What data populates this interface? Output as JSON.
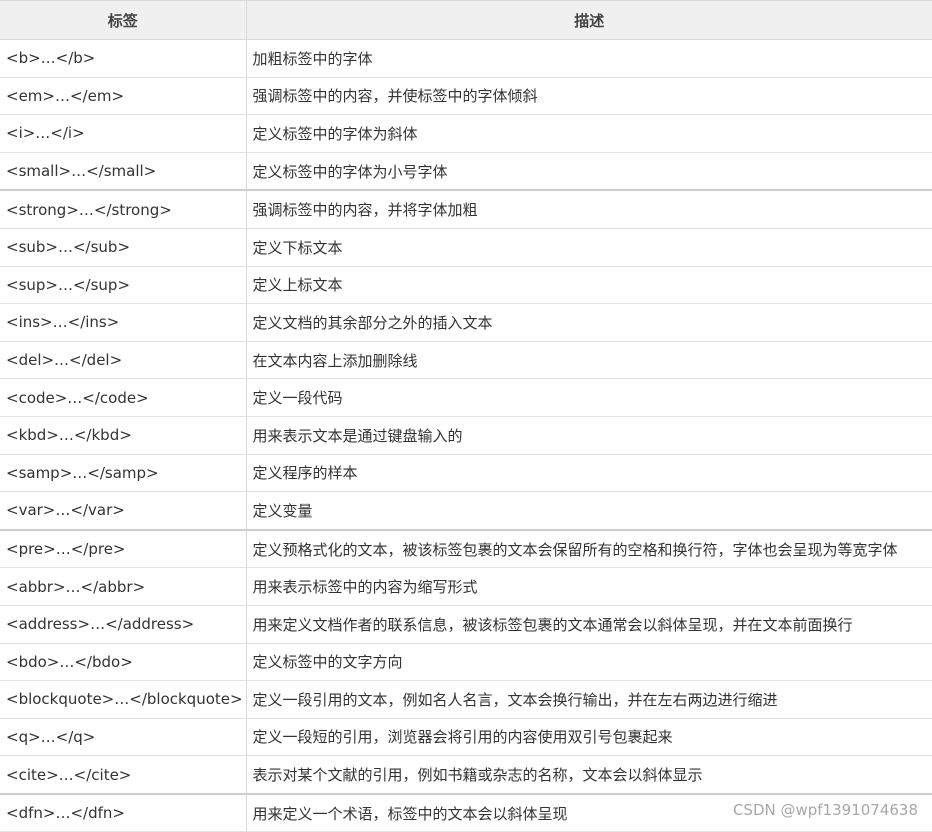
{
  "header": {
    "tag_label": "标签",
    "desc_label": "描述"
  },
  "rows": [
    {
      "tag": "<b>…</b>",
      "desc": "加粗标签中的字体"
    },
    {
      "tag": "<em>…</em>",
      "desc": "强调标签中的内容，并使标签中的字体倾斜"
    },
    {
      "tag": "<i>…</i>",
      "desc": "定义标签中的字体为斜体"
    },
    {
      "tag": "<small>…</small>",
      "desc": "定义标签中的字体为小号字体"
    },
    {
      "tag": "<strong>…</strong>",
      "desc": "强调标签中的内容，并将字体加粗"
    },
    {
      "tag": "<sub>…</sub>",
      "desc": "定义下标文本"
    },
    {
      "tag": "<sup>…</sup>",
      "desc": "定义上标文本"
    },
    {
      "tag": "<ins>…</ins>",
      "desc": "定义文档的其余部分之外的插入文本"
    },
    {
      "tag": "<del>…</del>",
      "desc": "在文本内容上添加删除线"
    },
    {
      "tag": "<code>…</code>",
      "desc": "定义一段代码"
    },
    {
      "tag": "<kbd>…</kbd>",
      "desc": "用来表示文本是通过键盘输入的"
    },
    {
      "tag": "<samp>…</samp>",
      "desc": "定义程序的样本"
    },
    {
      "tag": "<var>…</var>",
      "desc": "定义变量"
    },
    {
      "tag": "<pre>…</pre>",
      "desc": "定义预格式化的文本，被该标签包裹的文本会保留所有的空格和换行符，字体也会呈现为等宽字体"
    },
    {
      "tag": "<abbr>…</abbr>",
      "desc": "用来表示标签中的内容为缩写形式"
    },
    {
      "tag": "<address>…</address>",
      "desc": "用来定义文档作者的联系信息，被该标签包裹的文本通常会以斜体呈现，并在文本前面换行"
    },
    {
      "tag": "<bdo>…</bdo>",
      "desc": "定义标签中的文字方向"
    },
    {
      "tag": "<blockquote>…</blockquote>",
      "desc": "定义一段引用的文本，例如名人名言，文本会换行输出，并在左右两边进行缩进"
    },
    {
      "tag": "<q>…</q>",
      "desc": "定义一段短的引用，浏览器会将引用的内容使用双引号包裹起来"
    },
    {
      "tag": "<cite>…</cite>",
      "desc": "表示对某个文献的引用，例如书籍或杂志的名称，文本会以斜体显示"
    },
    {
      "tag": "<dfn>…</dfn>",
      "desc": "用来定义一个术语，标签中的文本会以斜体呈现"
    }
  ],
  "watermark": "CSDN @wpf1391074638"
}
